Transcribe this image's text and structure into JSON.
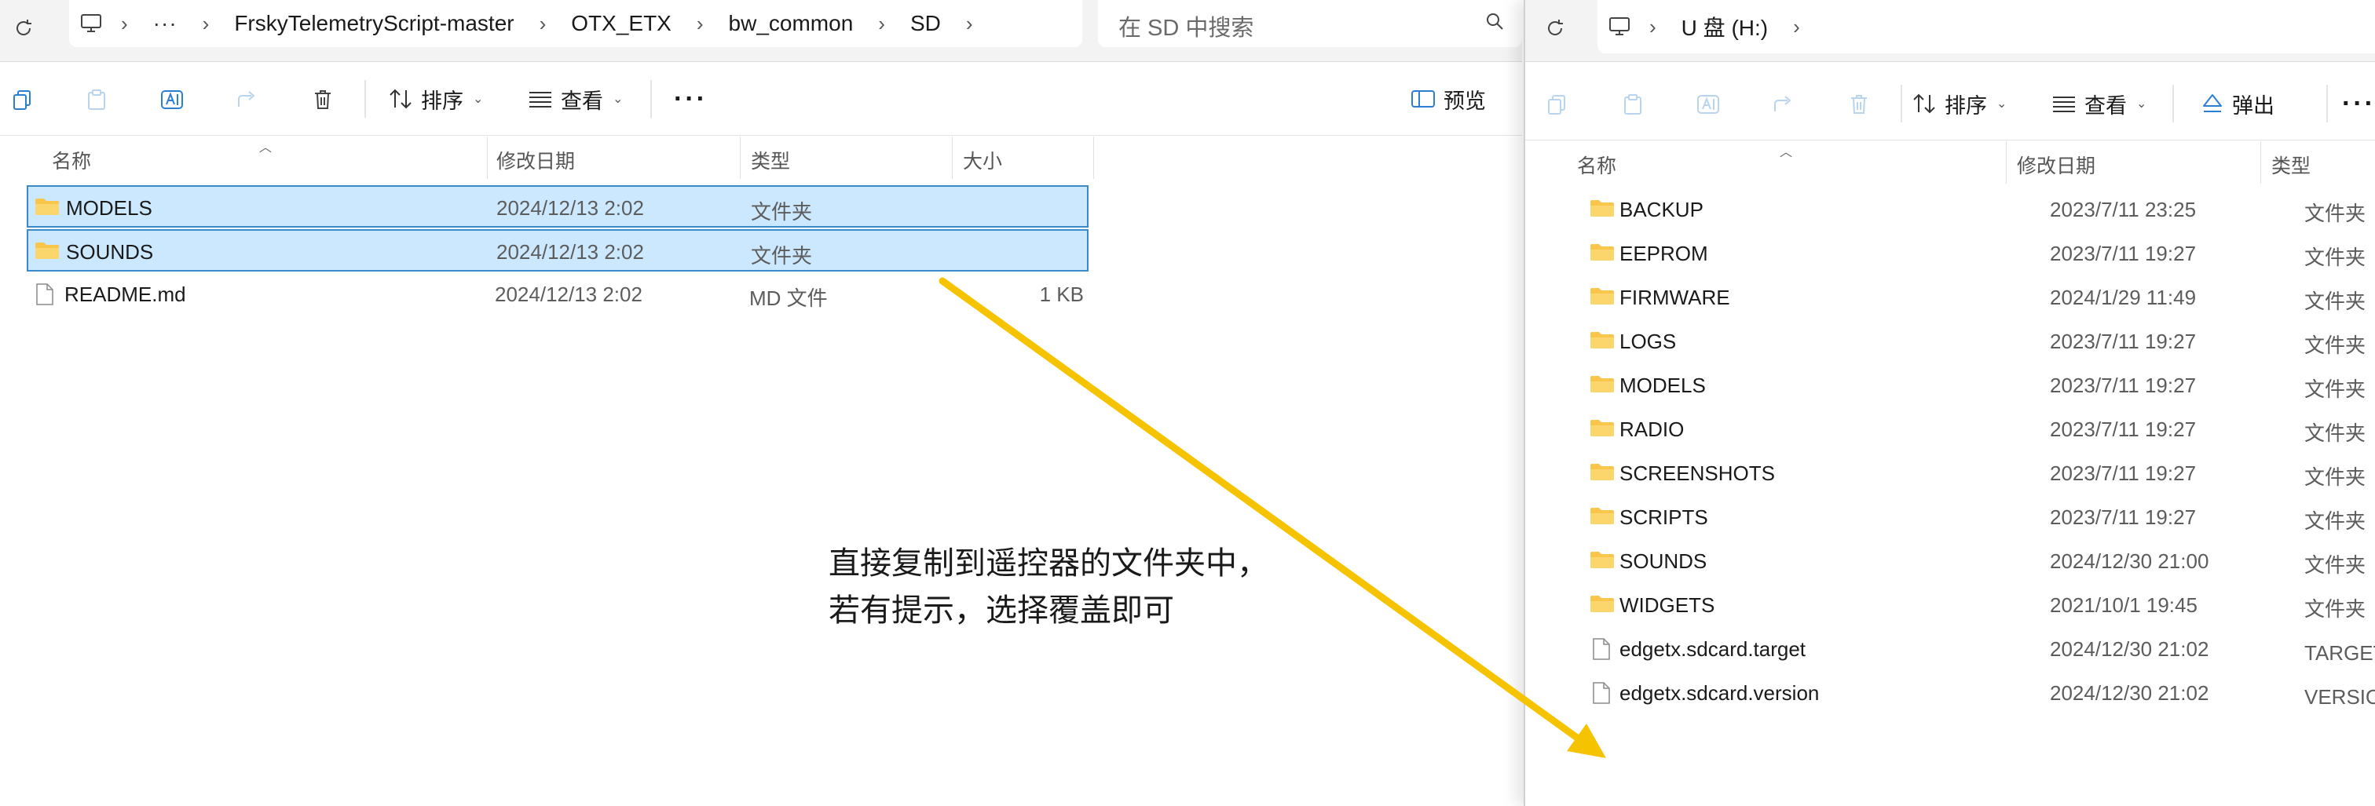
{
  "left": {
    "breadcrumb": [
      "FrskyTelemetryScript-master",
      "OTX_ETX",
      "bw_common",
      "SD"
    ],
    "search_placeholder": "在 SD 中搜索",
    "toolbar": {
      "sort_label": "排序",
      "view_label": "查看",
      "preview_label": "预览"
    },
    "columns": {
      "name": "名称",
      "modified": "修改日期",
      "type": "类型",
      "size": "大小"
    },
    "files": [
      {
        "name": "MODELS",
        "date": "2024/12/13 2:02",
        "type": "文件夹",
        "size": "",
        "icon": "folder-icon",
        "selected": true
      },
      {
        "name": "SOUNDS",
        "date": "2024/12/13 2:02",
        "type": "文件夹",
        "size": "",
        "icon": "folder-icon",
        "selected": true
      },
      {
        "name": "README.md",
        "date": "2024/12/13 2:02",
        "type": "MD 文件",
        "size": "1 KB",
        "icon": "file-icon",
        "selected": false
      }
    ]
  },
  "right": {
    "breadcrumb": [
      "U 盘 (H:)"
    ],
    "toolbar": {
      "sort_label": "排序",
      "view_label": "查看",
      "eject_label": "弹出"
    },
    "columns": {
      "name": "名称",
      "modified": "修改日期",
      "type": "类型"
    },
    "files": [
      {
        "name": "BACKUP",
        "date": "2023/7/11 23:25",
        "type": "文件夹",
        "icon": "folder-icon"
      },
      {
        "name": "EEPROM",
        "date": "2023/7/11 19:27",
        "type": "文件夹",
        "icon": "folder-icon"
      },
      {
        "name": "FIRMWARE",
        "date": "2024/1/29 11:49",
        "type": "文件夹",
        "icon": "folder-icon"
      },
      {
        "name": "LOGS",
        "date": "2023/7/11 19:27",
        "type": "文件夹",
        "icon": "folder-icon"
      },
      {
        "name": "MODELS",
        "date": "2023/7/11 19:27",
        "type": "文件夹",
        "icon": "folder-icon"
      },
      {
        "name": "RADIO",
        "date": "2023/7/11 19:27",
        "type": "文件夹",
        "icon": "folder-icon"
      },
      {
        "name": "SCREENSHOTS",
        "date": "2023/7/11 19:27",
        "type": "文件夹",
        "icon": "folder-icon"
      },
      {
        "name": "SCRIPTS",
        "date": "2023/7/11 19:27",
        "type": "文件夹",
        "icon": "folder-icon"
      },
      {
        "name": "SOUNDS",
        "date": "2024/12/30 21:00",
        "type": "文件夹",
        "icon": "folder-icon"
      },
      {
        "name": "WIDGETS",
        "date": "2021/10/1 19:45",
        "type": "文件夹",
        "icon": "folder-icon"
      },
      {
        "name": "edgetx.sdcard.target",
        "date": "2024/12/30 21:02",
        "type": "TARGET 文件",
        "icon": "file-icon"
      },
      {
        "name": "edgetx.sdcard.version",
        "date": "2024/12/30 21:02",
        "type": "VERSION 文件",
        "icon": "file-icon"
      }
    ]
  },
  "annotation": {
    "line1": "直接复制到遥控器的文件夹中，",
    "line2": "若有提示，选择覆盖即可"
  },
  "colors": {
    "selection_bg": "#cce8ff",
    "selection_border": "#3a89c9",
    "arrow": "#f5c300",
    "folder": "#f7c64b"
  }
}
